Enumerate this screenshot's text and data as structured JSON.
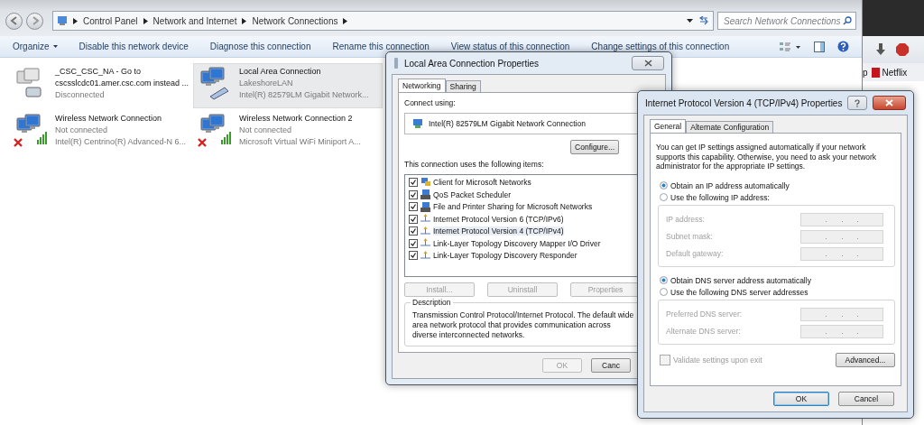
{
  "explorer": {
    "breadcrumb": [
      "Control Panel",
      "Network and Internet",
      "Network Connections"
    ],
    "search": {
      "placeholder": "Search Network Connections"
    },
    "toolbar": [
      {
        "label": "Organize",
        "kind": "menu"
      },
      {
        "label": "Disable this network device",
        "kind": "action"
      },
      {
        "label": "Diagnose this connection",
        "kind": "action"
      },
      {
        "label": "Rename this connection",
        "kind": "action"
      },
      {
        "label": "View status of this connection",
        "kind": "action"
      },
      {
        "label": "Change settings of this connection",
        "kind": "action"
      }
    ],
    "connections": [
      {
        "name": "_CSC_CSC_NA - Go to\ncscsslcdc01.amer.csc.com instead ...",
        "status": "Disconnected",
        "kind": "dialup",
        "selected": false,
        "error": false
      },
      {
        "name": "Local Area Connection",
        "status": "LakeshoreLAN",
        "device": "Intel(R) 82579LM Gigabit Network...",
        "kind": "wired",
        "selected": true,
        "error": false
      },
      {
        "name": "Wireless Network Connection",
        "status": "Not connected",
        "device": "Intel(R) Centrino(R) Advanced-N 6...",
        "kind": "wireless",
        "selected": false,
        "error": true
      },
      {
        "name": "Wireless Network Connection 2",
        "status": "Not connected",
        "device": "Microsoft Virtual WiFi Miniport A...",
        "kind": "wireless",
        "selected": false,
        "error": true
      }
    ]
  },
  "browser": {
    "bookmarks": [
      {
        "label": "p",
        "kind": "cut"
      },
      {
        "label": "Netflix",
        "kind": "netflix"
      }
    ]
  },
  "lan_dialog": {
    "title": "Local Area Connection Properties",
    "tabs": [
      {
        "label": "Networking",
        "selected": true
      },
      {
        "label": "Sharing",
        "selected": false
      }
    ],
    "connect_label": "Connect using:",
    "adapter": "Intel(R) 82579LM Gigabit Network Connection",
    "configure": "Configure...",
    "items_label": "This connection uses the following items:",
    "items": [
      {
        "label": "Client for Microsoft Networks",
        "kind": "client",
        "checked": true,
        "selected": false
      },
      {
        "label": "QoS Packet Scheduler",
        "kind": "service",
        "checked": true,
        "selected": false
      },
      {
        "label": "File and Printer Sharing for Microsoft Networks",
        "kind": "service",
        "checked": true,
        "selected": false
      },
      {
        "label": "Internet Protocol Version 6 (TCP/IPv6)",
        "kind": "protocol",
        "checked": true,
        "selected": false
      },
      {
        "label": "Internet Protocol Version 4 (TCP/IPv4)",
        "kind": "protocol",
        "checked": true,
        "selected": true
      },
      {
        "label": "Link-Layer Topology Discovery Mapper I/O Driver",
        "kind": "protocol",
        "checked": true,
        "selected": false
      },
      {
        "label": "Link-Layer Topology Discovery Responder",
        "kind": "protocol",
        "checked": true,
        "selected": false
      }
    ],
    "item_buttons": [
      {
        "label": "Install...",
        "disabled": true
      },
      {
        "label": "Uninstall",
        "disabled": true
      },
      {
        "label": "Properties",
        "disabled": true
      }
    ],
    "description_label": "Description",
    "description": "Transmission Control Protocol/Internet Protocol. The default wide\narea network protocol that provides communication across\ndiverse interconnected networks.",
    "buttons": [
      {
        "label": "OK",
        "disabled": true
      },
      {
        "label": "Canc",
        "disabled": false
      }
    ]
  },
  "ipv4_dialog": {
    "title": "Internet Protocol Version 4 (TCP/IPv4) Properties",
    "tabs": [
      {
        "label": "General",
        "selected": true
      },
      {
        "label": "Alternate Configuration",
        "selected": false
      }
    ],
    "intro": "You can get IP settings assigned automatically if your network\nsupports this capability. Otherwise, you need to ask your network\nadministrator for the appropriate IP settings.",
    "ip_options": [
      {
        "label": "Obtain an IP address automatically",
        "selected": true
      },
      {
        "label": "Use the following IP address:",
        "selected": false
      }
    ],
    "ip_fields": [
      {
        "label": "IP address:",
        "disabled": true
      },
      {
        "label": "Subnet mask:",
        "disabled": true
      },
      {
        "label": "Default gateway:",
        "disabled": true
      }
    ],
    "dns_options": [
      {
        "label": "Obtain DNS server address automatically",
        "selected": true
      },
      {
        "label": "Use the following DNS server addresses",
        "selected": false
      }
    ],
    "dns_fields": [
      {
        "label": "Preferred DNS server:",
        "disabled": true
      },
      {
        "label": "Alternate DNS server:",
        "disabled": true
      }
    ],
    "validate": {
      "label": "Validate settings upon exit",
      "checked": false,
      "disabled": true
    },
    "advanced": "Advanced...",
    "buttons": [
      {
        "label": "OK",
        "default": true
      },
      {
        "label": "Cancel",
        "default": false
      }
    ]
  }
}
